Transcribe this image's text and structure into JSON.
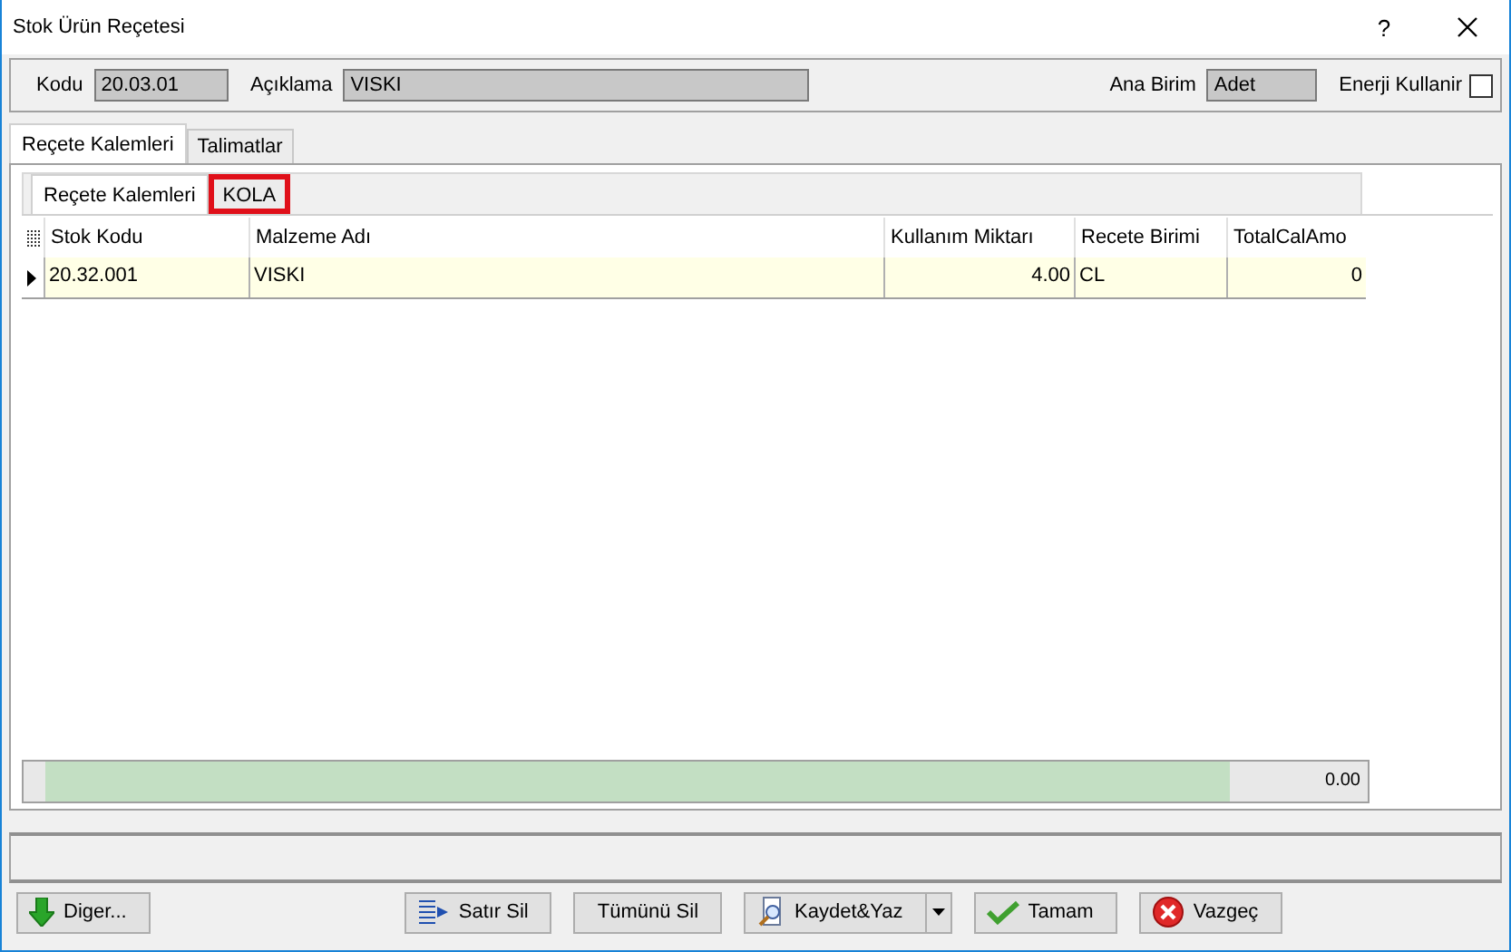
{
  "window": {
    "title": "Stok Ürün Reçetesi",
    "help": "?"
  },
  "header": {
    "fields": [
      {
        "label": "Kodu",
        "value": "20.03.01"
      },
      {
        "label": "Açıklama",
        "value": "VISKI"
      },
      {
        "label": "Ana Birim",
        "value": "Adet"
      }
    ],
    "checkbox": {
      "label": "Enerji Kullanir",
      "checked": false
    }
  },
  "tabs": [
    {
      "label": "Reçete Kalemleri",
      "selected": true
    },
    {
      "label": "Talimatlar",
      "selected": false
    }
  ],
  "inner_tabs": [
    {
      "label": "Reçete Kalemleri",
      "selected": true,
      "highlighted": false
    },
    {
      "label": "KOLA",
      "selected": false,
      "highlighted": true
    }
  ],
  "table": {
    "columns": [
      "Stok Kodu",
      "Malzeme Adı",
      "Kullanım Miktarı",
      "Recete Birimi",
      "TotalCalAmo"
    ],
    "rows": [
      {
        "cells": [
          "20.32.001",
          "VISKI",
          "4.00",
          "CL",
          "0"
        ],
        "current": true
      }
    ],
    "footer_total": "0.00"
  },
  "buttons": [
    {
      "label": "Diger..."
    },
    {
      "label": "Satır Sil"
    },
    {
      "label": "Tümünü Sil"
    },
    {
      "label": "Kaydet&Yaz",
      "dropdown": true
    },
    {
      "label": "Tamam"
    },
    {
      "label": "Vazgeç"
    }
  ]
}
